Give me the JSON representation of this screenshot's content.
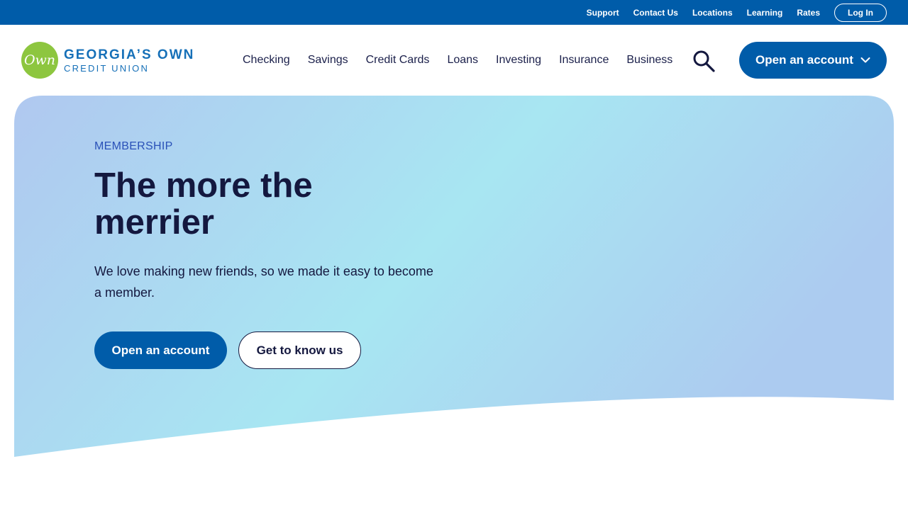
{
  "utility_nav": {
    "links": [
      "Support",
      "Contact Us",
      "Locations",
      "Learning",
      "Rates"
    ],
    "login_label": "Log In"
  },
  "logo": {
    "mark_text": "Own",
    "line1": "GEORGIA’S OWN",
    "line2": "CREDIT UNION"
  },
  "main_nav": {
    "items": [
      "Checking",
      "Savings",
      "Credit Cards",
      "Loans",
      "Investing",
      "Insurance",
      "Business"
    ],
    "search_icon": "search-icon",
    "cta_label": "Open an account",
    "cta_icon": "chevron-down-icon"
  },
  "hero": {
    "eyebrow": "MEMBERSHIP",
    "title": "The more the merrier",
    "body": "We love making new friends, so we made it easy to become a member.",
    "primary_button": "Open an account",
    "secondary_button": "Get to know us"
  },
  "colors": {
    "brand_blue": "#005ca9",
    "logo_green": "#8dc63f",
    "text_dark": "#14183f",
    "eyebrow_blue": "#2a51b8",
    "gradient_start": "#b0c8f0",
    "gradient_mid": "#a8e6f2",
    "gradient_end": "#accbf0"
  }
}
